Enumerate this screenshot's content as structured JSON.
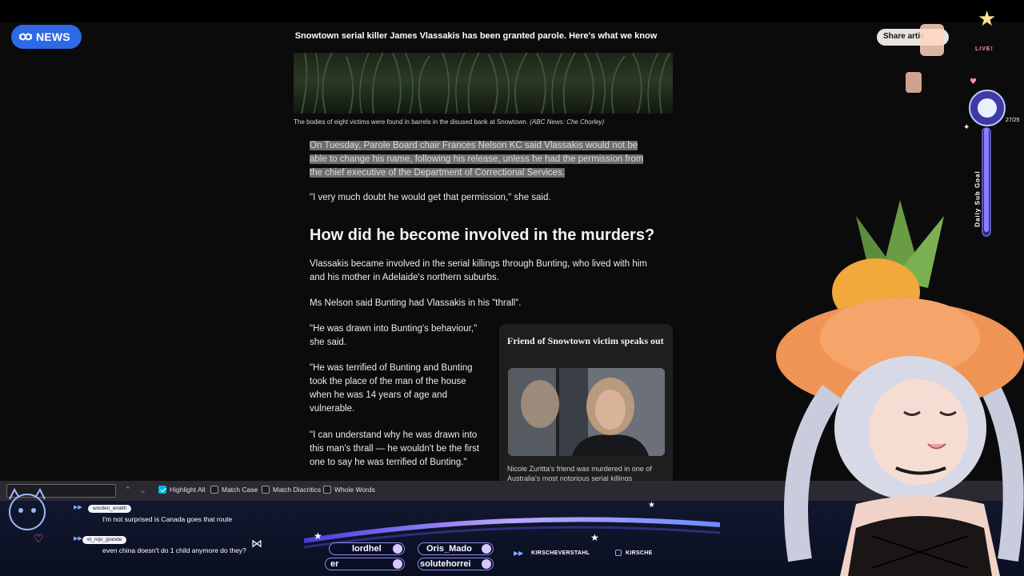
{
  "header": {
    "logo_text": "NEWS",
    "headline": "Snowtown serial killer James Vlassakis has been granted parole. Here's what we know",
    "share_label": "Share artic"
  },
  "article": {
    "caption": "The bodies of eight victims were found in barrels in the disused bank at Snowtown.",
    "caption_credit": "(ABC News: Che Chorley)",
    "selected_paragraph": "On Tuesday, Parole Board chair Frances Nelson KC said Vlassakis would not be able to change his name, following his release, unless he had the permission from the chief executive of the Department of Correctional Services.",
    "quote1": "\"I very much doubt he would get that permission,\" she said.",
    "heading": "How did he become involved in the murders?",
    "became": "Vlassakis became involved in the serial killings through Bunting, who lived with him and his mother in Adelaide's northern suburbs.",
    "nelson": "Ms Nelson said Bunting had Vlassakis in his \"thrall\".",
    "drawn": "\"He was drawn into Bunting's behaviour,\" she said.",
    "terrified": "\"He was terrified of Bunting and Bunting took the place of the man of the house when he was 14 years of age and vulnerable.",
    "understand": "\"I can understand why he was drawn into this man's thrall — he wouldn't be the first one to say he was terrified of Bunting.\"",
    "card": {
      "title": "Friend of Snowtown victim speaks out",
      "caption": "Nicole Zuritta's friend was murdered in one of Australia's most notorious serial killings"
    }
  },
  "findbar": {
    "prev_icon": "chevron-up-icon",
    "next_icon": "chevron-down-icon",
    "highlight_all": "Highlight All",
    "highlight_all_checked": true,
    "match_case": "Match Case",
    "match_diacritics": "Match Diacritics",
    "whole_words": "Whole Words"
  },
  "stream": {
    "live_label": "LIVE!",
    "sub_count": "27/25",
    "sub_goal": "Daily Sub Goal",
    "chat": [
      {
        "user": "worden_wralth",
        "message": "I'm not surprised is Canada goes that route"
      },
      {
        "user": "el_rojo_grande",
        "message": "even china doesn't do 1 child anymore do they?"
      }
    ],
    "ticker": [
      "lordhel",
      "Oris_Mado",
      "er",
      "solutehorrei"
    ],
    "follow_labels": [
      "KIRSCHEVERSTAHL",
      "KIRSCHE"
    ],
    "colors": {
      "accent": "#2e6ae6",
      "highlight": "#00b8d9",
      "overlay": "#11172e"
    }
  }
}
